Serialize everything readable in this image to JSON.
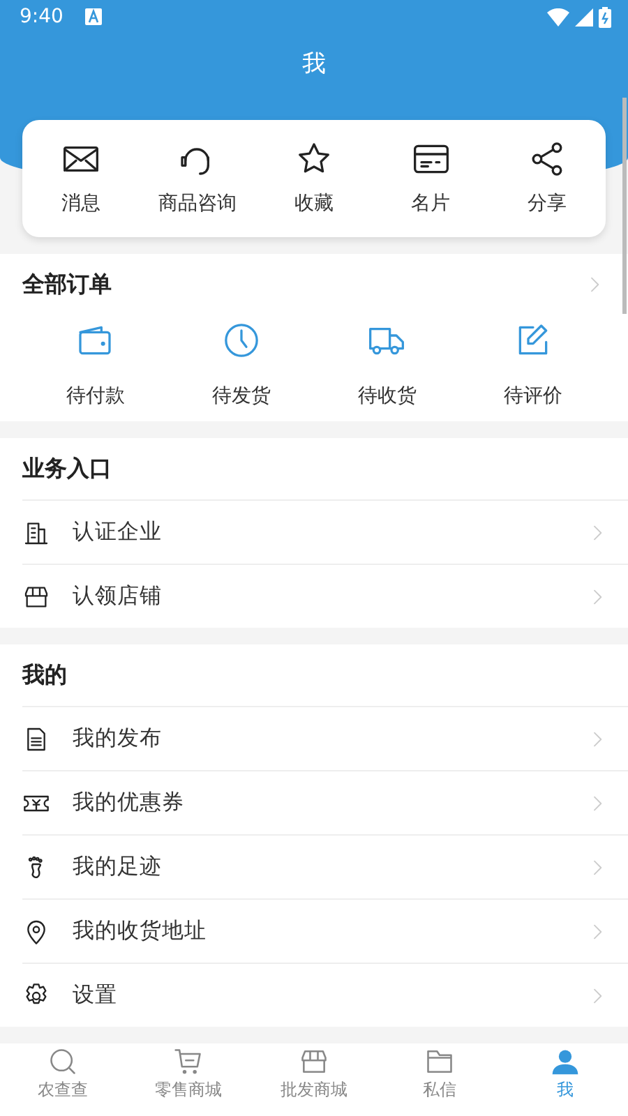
{
  "status_bar": {
    "time": "9:40"
  },
  "header": {
    "title": "我"
  },
  "quick_actions": [
    {
      "label": "消息"
    },
    {
      "label": "商品咨询"
    },
    {
      "label": "收藏"
    },
    {
      "label": "名片"
    },
    {
      "label": "分享"
    }
  ],
  "orders": {
    "title": "全部订单",
    "items": [
      {
        "label": "待付款"
      },
      {
        "label": "待发货"
      },
      {
        "label": "待收货"
      },
      {
        "label": "待评价"
      }
    ]
  },
  "business": {
    "title": "业务入口",
    "items": [
      {
        "label": "认证企业"
      },
      {
        "label": "认领店铺"
      }
    ]
  },
  "mine": {
    "title": "我的",
    "items": [
      {
        "label": "我的发布"
      },
      {
        "label": "我的优惠券"
      },
      {
        "label": "我的足迹"
      },
      {
        "label": "我的收货地址"
      },
      {
        "label": "设置"
      }
    ]
  },
  "tab_bar": [
    {
      "label": "农查查",
      "selected": false
    },
    {
      "label": "零售商城",
      "selected": false
    },
    {
      "label": "批发商城",
      "selected": false
    },
    {
      "label": "私信",
      "selected": false
    },
    {
      "label": "我",
      "selected": true
    }
  ]
}
